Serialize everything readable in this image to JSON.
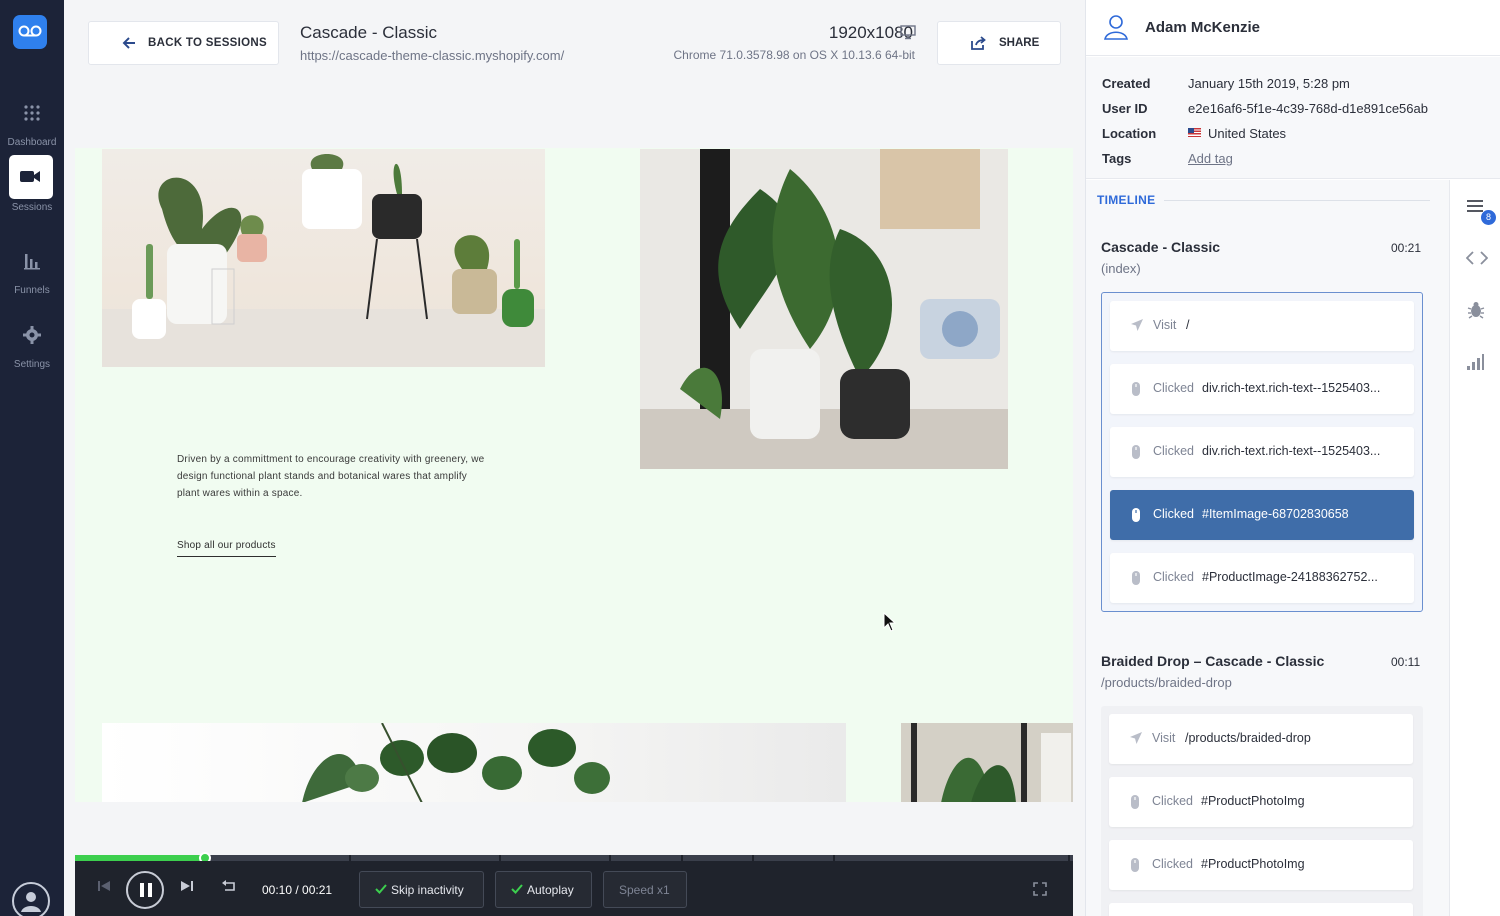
{
  "nav": {
    "items": [
      {
        "label": "Dashboard",
        "icon": "grid-icon"
      },
      {
        "label": "Sessions",
        "icon": "video-camera-icon",
        "active": true
      },
      {
        "label": "Funnels",
        "icon": "bar-chart-icon"
      },
      {
        "label": "Settings",
        "icon": "gear-icon"
      }
    ]
  },
  "header": {
    "back_label": "BACK TO SESSIONS",
    "site_title": "Cascade - Classic",
    "site_url": "https://cascade-theme-classic.myshopify.com/",
    "resolution": "1920x1080",
    "browser": "Chrome 71.0.3578.98 on OS X 10.13.6 64-bit",
    "share_label": "SHARE"
  },
  "page": {
    "blurb": "Driven by a committment to encourage creativity with greenery, we design functional plant stands and botanical wares that amplify plant wares within a space.",
    "shop_link": "Shop all our products"
  },
  "player": {
    "time": "00:10 / 00:21",
    "progress": 0.13,
    "skip_inactivity": "Skip inactivity",
    "autoplay": "Autoplay",
    "speed": "Speed x1"
  },
  "user": {
    "name": "Adam McKenzie",
    "created_label": "Created",
    "created": "January 15th 2019, 5:28 pm",
    "userid_label": "User ID",
    "userid": "e2e16af6-5f1e-4c39-768d-d1e891ce56ab",
    "location_label": "Location",
    "location": "United States",
    "tags_label": "Tags",
    "add_tag": "Add tag"
  },
  "timeline": {
    "label": "TIMELINE",
    "badge": "8",
    "pages": [
      {
        "title": "Cascade - Classic",
        "path": "(index)",
        "duration": "00:21",
        "events": [
          {
            "type": "Visit",
            "detail": "/"
          },
          {
            "type": "Clicked",
            "detail": "div.rich-text.rich-text--1525403..."
          },
          {
            "type": "Clicked",
            "detail": "div.rich-text.rich-text--1525403..."
          },
          {
            "type": "Clicked",
            "detail": "#ItemImage-68702830658",
            "active": true
          },
          {
            "type": "Clicked",
            "detail": "#ProductImage-24188362752..."
          }
        ]
      },
      {
        "title": "Braided Drop – Cascade - Classic",
        "path": "/products/braided-drop",
        "duration": "00:11",
        "events": [
          {
            "type": "Visit",
            "detail": "/products/braided-drop"
          },
          {
            "type": "Clicked",
            "detail": "#ProductPhotoImg"
          },
          {
            "type": "Clicked",
            "detail": "#ProductPhotoImg"
          }
        ]
      }
    ]
  },
  "colors": {
    "nav_bg": "#1c2338",
    "accent": "#2f80ed",
    "active_event": "#3f6da9",
    "progress": "#3ccf4e"
  }
}
